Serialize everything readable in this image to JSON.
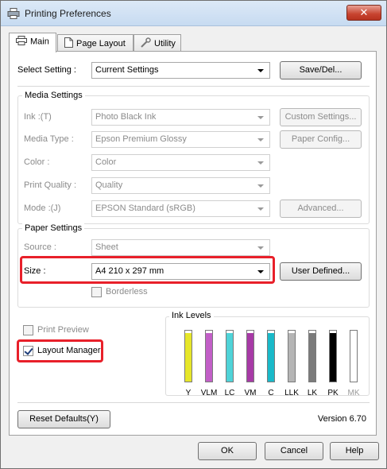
{
  "window": {
    "title": "Printing Preferences",
    "close_label": "✕"
  },
  "tabs": [
    {
      "label": "Main",
      "icon": "printer-icon"
    },
    {
      "label": "Page Layout",
      "icon": "page-icon"
    },
    {
      "label": "Utility",
      "icon": "wrench-icon"
    }
  ],
  "select_setting": {
    "label": "Select Setting :",
    "value": "Current Settings",
    "save_button": "Save/Del..."
  },
  "media_settings": {
    "title": "Media Settings",
    "ink": {
      "label": "Ink :(T)",
      "value": "Photo Black Ink",
      "button": "Custom Settings..."
    },
    "media_type": {
      "label": "Media Type :",
      "value": "Epson Premium Glossy",
      "button": "Paper Config..."
    },
    "color": {
      "label": "Color :",
      "value": "Color"
    },
    "print_quality": {
      "label": "Print Quality :",
      "value": "Quality"
    },
    "mode": {
      "label": "Mode :(J)",
      "value": "EPSON Standard (sRGB)",
      "button": "Advanced..."
    }
  },
  "paper_settings": {
    "title": "Paper Settings",
    "source": {
      "label": "Source :",
      "value": "Sheet"
    },
    "size": {
      "label": "Size :",
      "value": "A4 210 x 297 mm",
      "button": "User Defined..."
    },
    "borderless": {
      "label": "Borderless",
      "checked": false
    }
  },
  "print_preview": {
    "label": "Print Preview",
    "checked": false
  },
  "layout_manager": {
    "label": "Layout Manager",
    "checked": true
  },
  "ink_levels": {
    "title": "Ink Levels",
    "inks": [
      {
        "name": "Y",
        "color": "#e6e62a",
        "level": 0.95
      },
      {
        "name": "VLM",
        "color": "#c25fc7",
        "level": 0.95
      },
      {
        "name": "LC",
        "color": "#4fd3d8",
        "level": 0.95
      },
      {
        "name": "VM",
        "color": "#a73aa6",
        "level": 0.95
      },
      {
        "name": "C",
        "color": "#19b9c9",
        "level": 0.95
      },
      {
        "name": "LLK",
        "color": "#b5b5b5",
        "level": 0.95
      },
      {
        "name": "LK",
        "color": "#7b7b7b",
        "level": 0.95
      },
      {
        "name": "PK",
        "color": "#000000",
        "level": 0.95
      },
      {
        "name": "MK",
        "color": "#ffffff",
        "level": 0.0
      }
    ]
  },
  "footer": {
    "reset_button": "Reset Defaults(Y)",
    "version": "Version 6.70"
  },
  "dialog_buttons": {
    "ok": "OK",
    "cancel": "Cancel",
    "help": "Help"
  },
  "colors": {
    "highlight": "#e8202a"
  }
}
